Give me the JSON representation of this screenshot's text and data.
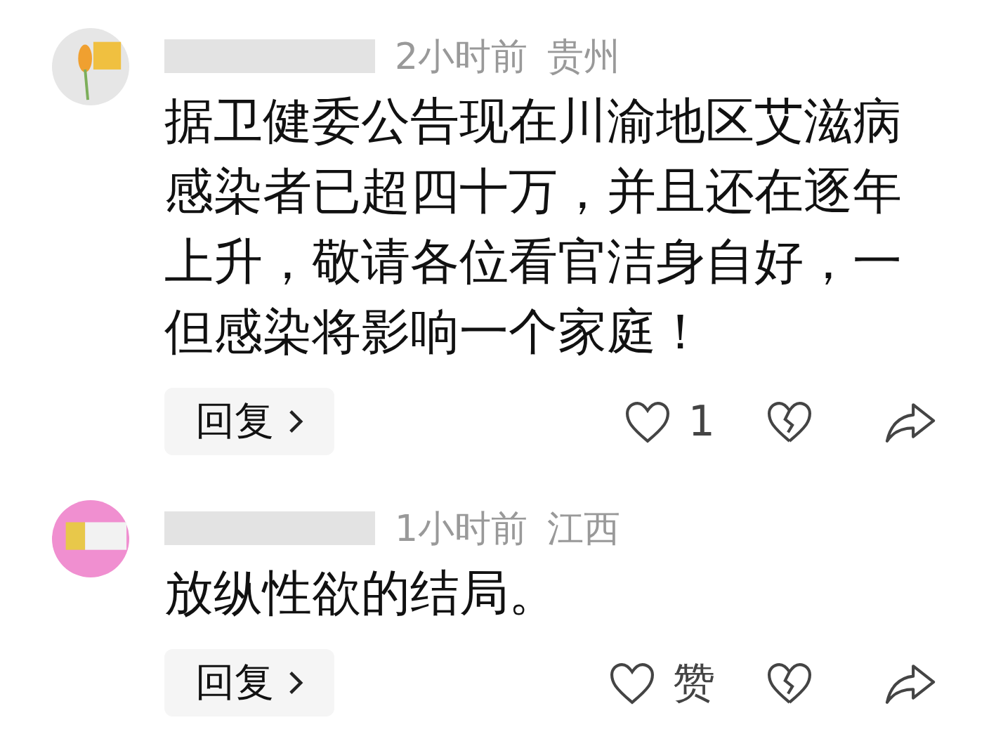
{
  "comments": [
    {
      "kind": "flower",
      "time": "2小时前",
      "location": "贵州",
      "text": "据卫健委公告现在川渝地区艾滋病感染者已超四十万，并且还在逐年上升，敬请各位看官洁身自好，一但感染将影响一个家庭！",
      "reply": "回复",
      "likes": "1",
      "liked": false
    },
    {
      "kind": "pink",
      "time": "1小时前",
      "location": "江西",
      "text": "放纵性欲的结局。",
      "reply": "回复",
      "likes": "赞",
      "liked": false
    }
  ]
}
